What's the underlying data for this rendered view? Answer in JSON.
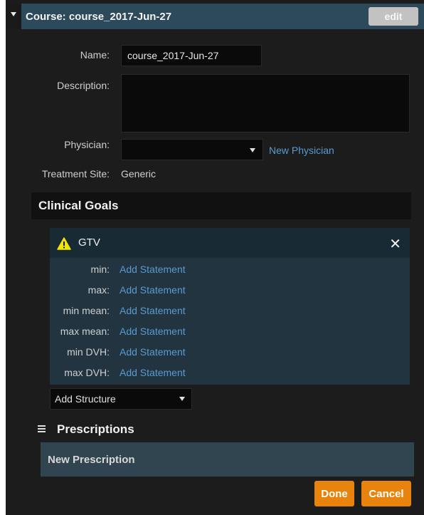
{
  "header": {
    "title": "Course: course_2017-Jun-27",
    "edit_label": "edit"
  },
  "form": {
    "name_label": "Name:",
    "name_value": "course_2017-Jun-27",
    "description_label": "Description:",
    "description_value": "",
    "physician_label": "Physician:",
    "physician_value": "",
    "new_physician_link": "New Physician",
    "treatment_site_label": "Treatment Site:",
    "treatment_site_value": "Generic"
  },
  "clinical_goals": {
    "title": "Clinical Goals",
    "structure": {
      "name": "GTV",
      "statements": [
        {
          "label": "min:",
          "link": "Add Statement"
        },
        {
          "label": "max:",
          "link": "Add Statement"
        },
        {
          "label": "min mean:",
          "link": "Add Statement"
        },
        {
          "label": "max mean:",
          "link": "Add Statement"
        },
        {
          "label": "min DVH:",
          "link": "Add Statement"
        },
        {
          "label": "max DVH:",
          "link": "Add Statement"
        }
      ]
    },
    "add_structure_label": "Add Structure"
  },
  "prescriptions": {
    "title": "Prescriptions",
    "new_prescription_label": "New Prescription"
  },
  "buttons": {
    "done_label": "Done",
    "cancel_label": "Cancel"
  },
  "colors": {
    "header_bg": "#2d4a5a",
    "link": "#5b9ad0",
    "accent": "#e8840e",
    "warning": "#f2e600"
  },
  "icons": {
    "collapse": "caret-down-icon",
    "warning": "warning-icon",
    "close": "close-icon",
    "dropdown": "chevron-down-icon",
    "prescriptions": "hamburger-icon"
  }
}
